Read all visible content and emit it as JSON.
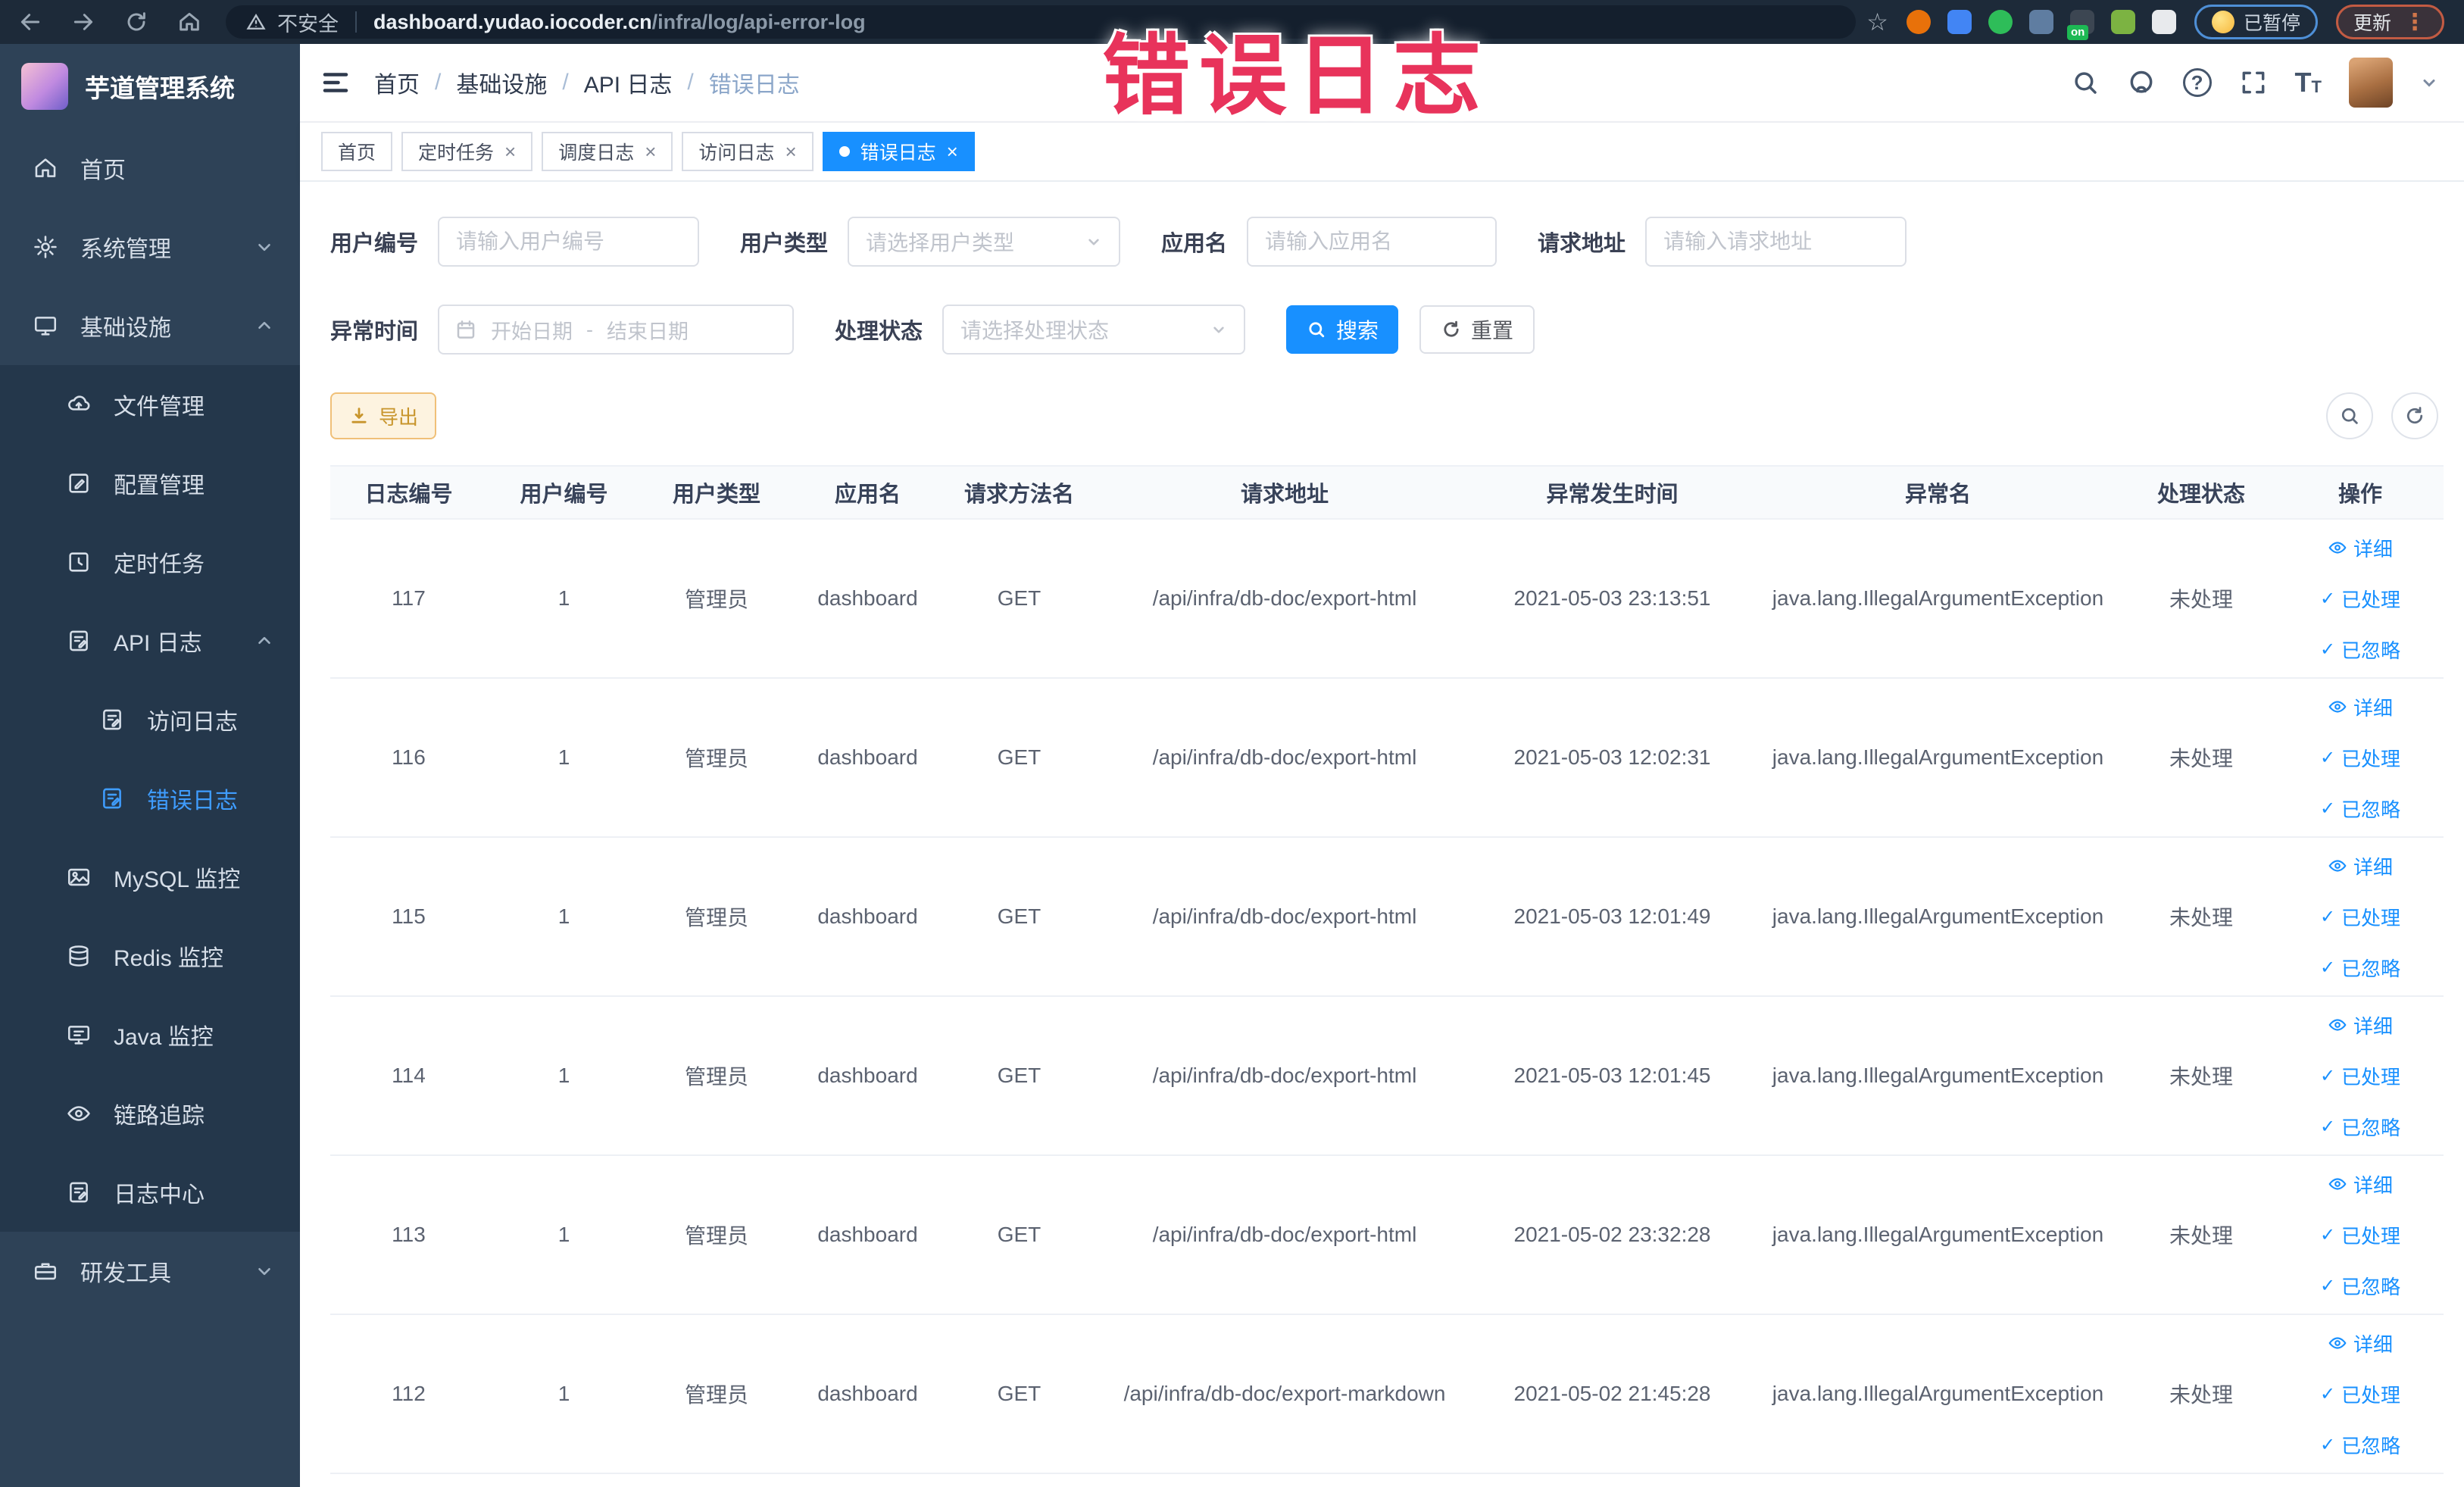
{
  "browser": {
    "security_label": "不安全",
    "url_domain": "dashboard.yudao.iocoder.cn",
    "url_path": "/infra/log/api-error-log",
    "extensions": [
      {
        "name": "extension-orange-target-icon",
        "color": "#e8710a",
        "round": true
      },
      {
        "name": "extension-blue-shield-icon",
        "color": "#4285f4",
        "round": false
      },
      {
        "name": "extension-green-y-icon",
        "color": "#2ebd59",
        "round": true
      },
      {
        "name": "extension-grid-icon",
        "color": "#5f7da1",
        "round": false
      },
      {
        "name": "extension-dark-on-icon",
        "color": "#3c4652",
        "round": false,
        "badge": "on"
      },
      {
        "name": "extension-plant-icon",
        "color": "#7cb342",
        "round": false
      },
      {
        "name": "extension-puzzle-icon",
        "color": "#e8eaed",
        "round": false
      }
    ],
    "paused_label": "已暂停",
    "update_label": "更新"
  },
  "watermark": {
    "text": "错误日志",
    "color": "#e8335b"
  },
  "sidebar": {
    "logo_title": "芋道管理系统",
    "items": [
      {
        "label": "首页",
        "icon": "home",
        "level": 0
      },
      {
        "label": "系统管理",
        "icon": "gear",
        "level": 0,
        "chevron": "down"
      },
      {
        "label": "基础设施",
        "icon": "monitor",
        "level": 0,
        "chevron": "up"
      },
      {
        "label": "文件管理",
        "icon": "upload",
        "level": 1,
        "dark": true
      },
      {
        "label": "配置管理",
        "icon": "edit",
        "level": 1,
        "dark": true
      },
      {
        "label": "定时任务",
        "icon": "clock",
        "level": 1,
        "dark": true
      },
      {
        "label": "API 日志",
        "icon": "logdoc",
        "level": 1,
        "chevron": "up",
        "dark": true
      },
      {
        "label": "访问日志",
        "icon": "logdoc",
        "level": 2,
        "dark": true
      },
      {
        "label": "错误日志",
        "icon": "logdoc",
        "level": 2,
        "dark": true,
        "active": true
      },
      {
        "label": "MySQL 监控",
        "icon": "image",
        "level": 1,
        "dark": true
      },
      {
        "label": "Redis 监控",
        "icon": "layers",
        "level": 1,
        "dark": true
      },
      {
        "label": "Java 监控",
        "icon": "screen",
        "level": 1,
        "dark": true
      },
      {
        "label": "链路追踪",
        "icon": "eye",
        "level": 1,
        "dark": true
      },
      {
        "label": "日志中心",
        "icon": "logdoc",
        "level": 1,
        "dark": true
      },
      {
        "label": "研发工具",
        "icon": "toolbox",
        "level": 0,
        "chevron": "down"
      }
    ]
  },
  "header": {
    "breadcrumb": [
      "首页",
      "基础设施",
      "API 日志",
      "错误日志"
    ]
  },
  "tabs": [
    {
      "label": "首页",
      "closable": false,
      "active": false
    },
    {
      "label": "定时任务",
      "closable": true,
      "active": false
    },
    {
      "label": "调度日志",
      "closable": true,
      "active": false
    },
    {
      "label": "访问日志",
      "closable": true,
      "active": false
    },
    {
      "label": "错误日志",
      "closable": true,
      "active": true
    }
  ],
  "filters": {
    "user_id_label": "用户编号",
    "user_id_placeholder": "请输入用户编号",
    "user_type_label": "用户类型",
    "user_type_placeholder": "请选择用户类型",
    "app_name_label": "应用名",
    "app_name_placeholder": "请输入应用名",
    "request_url_label": "请求地址",
    "request_url_placeholder": "请输入请求地址",
    "exception_time_label": "异常时间",
    "date_start_placeholder": "开始日期",
    "date_separator": "-",
    "date_end_placeholder": "结束日期",
    "process_status_label": "处理状态",
    "process_status_placeholder": "请选择处理状态",
    "search_button": "搜索",
    "reset_button": "重置"
  },
  "toolbar": {
    "export_label": "导出"
  },
  "table": {
    "headers": [
      "日志编号",
      "用户编号",
      "用户类型",
      "应用名",
      "请求方法名",
      "请求地址",
      "异常发生时间",
      "异常名",
      "处理状态",
      "操作"
    ],
    "actions": [
      "详细",
      "已处理",
      "已忽略"
    ],
    "rows": [
      {
        "id": "117",
        "user_id": "1",
        "user_type": "管理员",
        "app_name": "dashboard",
        "method": "GET",
        "url": "/api/infra/db-doc/export-html",
        "time": "2021-05-03 23:13:51",
        "exception": "java.lang.IllegalArgumentException",
        "status": "未处理"
      },
      {
        "id": "116",
        "user_id": "1",
        "user_type": "管理员",
        "app_name": "dashboard",
        "method": "GET",
        "url": "/api/infra/db-doc/export-html",
        "time": "2021-05-03 12:02:31",
        "exception": "java.lang.IllegalArgumentException",
        "status": "未处理"
      },
      {
        "id": "115",
        "user_id": "1",
        "user_type": "管理员",
        "app_name": "dashboard",
        "method": "GET",
        "url": "/api/infra/db-doc/export-html",
        "time": "2021-05-03 12:01:49",
        "exception": "java.lang.IllegalArgumentException",
        "status": "未处理"
      },
      {
        "id": "114",
        "user_id": "1",
        "user_type": "管理员",
        "app_name": "dashboard",
        "method": "GET",
        "url": "/api/infra/db-doc/export-html",
        "time": "2021-05-03 12:01:45",
        "exception": "java.lang.IllegalArgumentException",
        "status": "未处理"
      },
      {
        "id": "113",
        "user_id": "1",
        "user_type": "管理员",
        "app_name": "dashboard",
        "method": "GET",
        "url": "/api/infra/db-doc/export-html",
        "time": "2021-05-02 23:32:28",
        "exception": "java.lang.IllegalArgumentException",
        "status": "未处理"
      },
      {
        "id": "112",
        "user_id": "1",
        "user_type": "管理员",
        "app_name": "dashboard",
        "method": "GET",
        "url": "/api/infra/db-doc/export-markdown",
        "time": "2021-05-02 21:45:28",
        "exception": "java.lang.IllegalArgumentException",
        "status": "未处理"
      }
    ]
  }
}
